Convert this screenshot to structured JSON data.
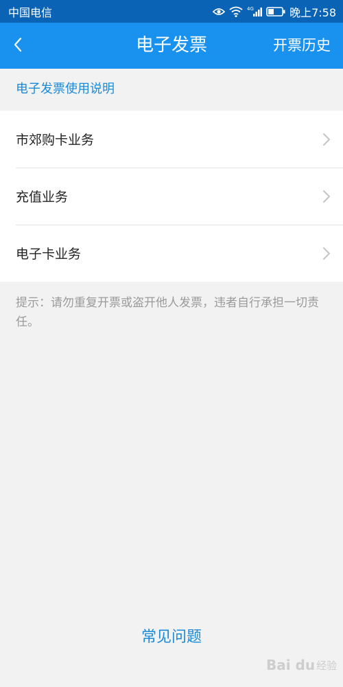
{
  "status_bar": {
    "carrier": "中国电信",
    "network_type": "4G",
    "time": "晚上7:58",
    "icons": [
      "eye-icon",
      "wifi-icon",
      "cellular-signal-icon",
      "battery-icon"
    ]
  },
  "nav": {
    "title": "电子发票",
    "action": "开票历史",
    "back_icon": "chevron-left-icon"
  },
  "guide_link": "电子发票使用说明",
  "menu": {
    "items": [
      {
        "label": "市郊购卡业务"
      },
      {
        "label": "充值业务"
      },
      {
        "label": "电子卡业务"
      }
    ],
    "item_icon": "chevron-right-icon"
  },
  "notice": "提示：请勿重复开票或盗开他人发票，违者自行承担一切责任。",
  "faq_link": "常见问题",
  "watermark": {
    "logo": "Bai du",
    "sub": "经验"
  },
  "colors": {
    "status_bar": "#0a63b5",
    "nav_bar": "#1992ef",
    "accent_text": "#1a8ad8",
    "background": "#f2f2f2",
    "notice_text": "#9a9a9a"
  }
}
